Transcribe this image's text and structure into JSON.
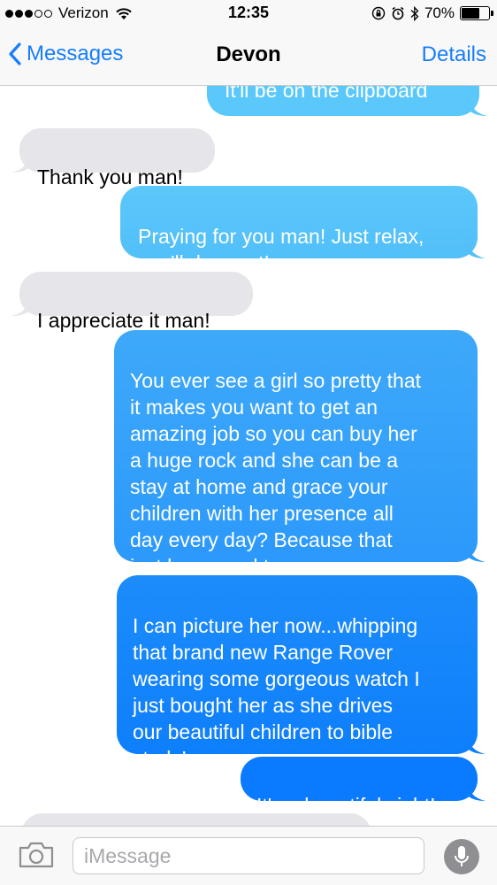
{
  "status_bar": {
    "carrier": "Verizon",
    "time": "12:35",
    "battery": "70%",
    "battery_level": 0.7,
    "signal_bars_filled": 3,
    "signal_bars_total": 5
  },
  "nav": {
    "back_label": "Messages",
    "title": "Devon",
    "details_label": "Details"
  },
  "messages": [
    {
      "from": "me",
      "text": "It'll be on the clipboard"
    },
    {
      "from": "them",
      "text": "Thank you man!"
    },
    {
      "from": "me",
      "text": "Praying for you man! Just relax,\nyou'll do great!"
    },
    {
      "from": "them",
      "text": "I appreciate it man!"
    },
    {
      "from": "me",
      "text": "You ever see a girl so pretty that\nit makes you want to get an\namazing job so you can buy her\na huge rock and she can be a\nstay at home and grace your\nchildren with her presence all\nday every day? Because that\njust happened to me"
    },
    {
      "from": "me",
      "text": "I can picture her now...whipping\nthat brand new Range Rover\nwearing some gorgeous watch I\njust bought her as she drives\nour beautiful children to bible\nstudy!"
    },
    {
      "from": "me",
      "text": "It's a beautiful sight!"
    },
    {
      "from": "them",
      "text": ""
    }
  ],
  "input": {
    "placeholder": "iMessage"
  },
  "colors": {
    "accent": "#157efb",
    "bubble_gray": "#e5e5ea",
    "bubble_blue_top": "#5ac8fa",
    "bubble_blue_bottom": "#0a7aff"
  },
  "icons": {
    "back": "chevron-left-icon",
    "camera": "camera-icon",
    "mic": "microphone-icon",
    "wifi": "wifi-icon",
    "lock": "orientation-lock-icon",
    "alarm": "alarm-icon",
    "bluetooth": "bluetooth-icon"
  }
}
